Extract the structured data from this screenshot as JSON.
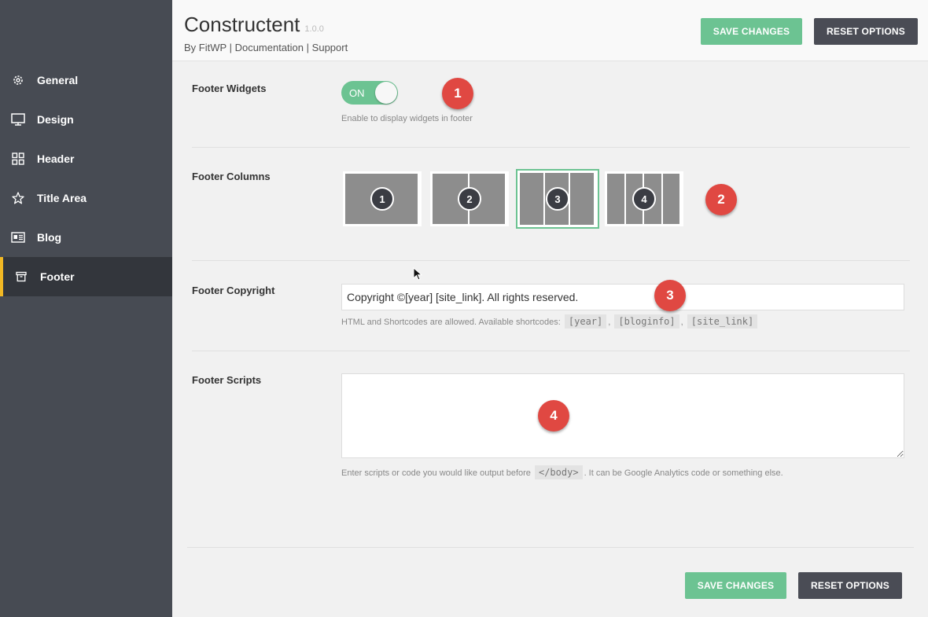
{
  "header": {
    "title": "Constructent",
    "version": "1.0.0",
    "by_label": "By FitWP",
    "separator": "|",
    "documentation_link": "Documentation",
    "support_link": "Support",
    "save_label": "SAVE CHANGES",
    "reset_label": "RESET OPTIONS"
  },
  "sidebar": {
    "items": [
      {
        "label": "General",
        "icon": "gear-icon"
      },
      {
        "label": "Design",
        "icon": "monitor-icon"
      },
      {
        "label": "Header",
        "icon": "grid-icon"
      },
      {
        "label": "Title Area",
        "icon": "star-icon"
      },
      {
        "label": "Blog",
        "icon": "newspaper-icon"
      },
      {
        "label": "Footer",
        "icon": "archive-icon",
        "active": true
      }
    ]
  },
  "footer_widgets": {
    "label": "Footer Widgets",
    "toggle_text": "ON",
    "help": "Enable to display widgets in footer",
    "marker": "1"
  },
  "footer_columns": {
    "label": "Footer Columns",
    "options": [
      "1",
      "2",
      "3",
      "4"
    ],
    "selected": "3",
    "marker": "2"
  },
  "footer_copyright": {
    "label": "Footer Copyright",
    "value": "Copyright ©[year] [site_link]. All rights reserved.",
    "help_prefix": "HTML and Shortcodes are allowed. Available shortcodes:",
    "shortcodes": [
      "[year]",
      "[bloginfo]",
      "[site_link]"
    ],
    "comma": ",",
    "marker": "3"
  },
  "footer_scripts": {
    "label": "Footer Scripts",
    "value": "",
    "help_prefix": "Enter scripts or code you would like output before",
    "help_code": "</body>",
    "help_suffix": ". It can be Google Analytics code or something else.",
    "marker": "4"
  },
  "colors": {
    "accent_green": "#6cc392",
    "dark_button": "#4a4c55",
    "sidebar_bg": "#474b53",
    "active_border": "#f1b824",
    "marker_red": "#e04842"
  }
}
